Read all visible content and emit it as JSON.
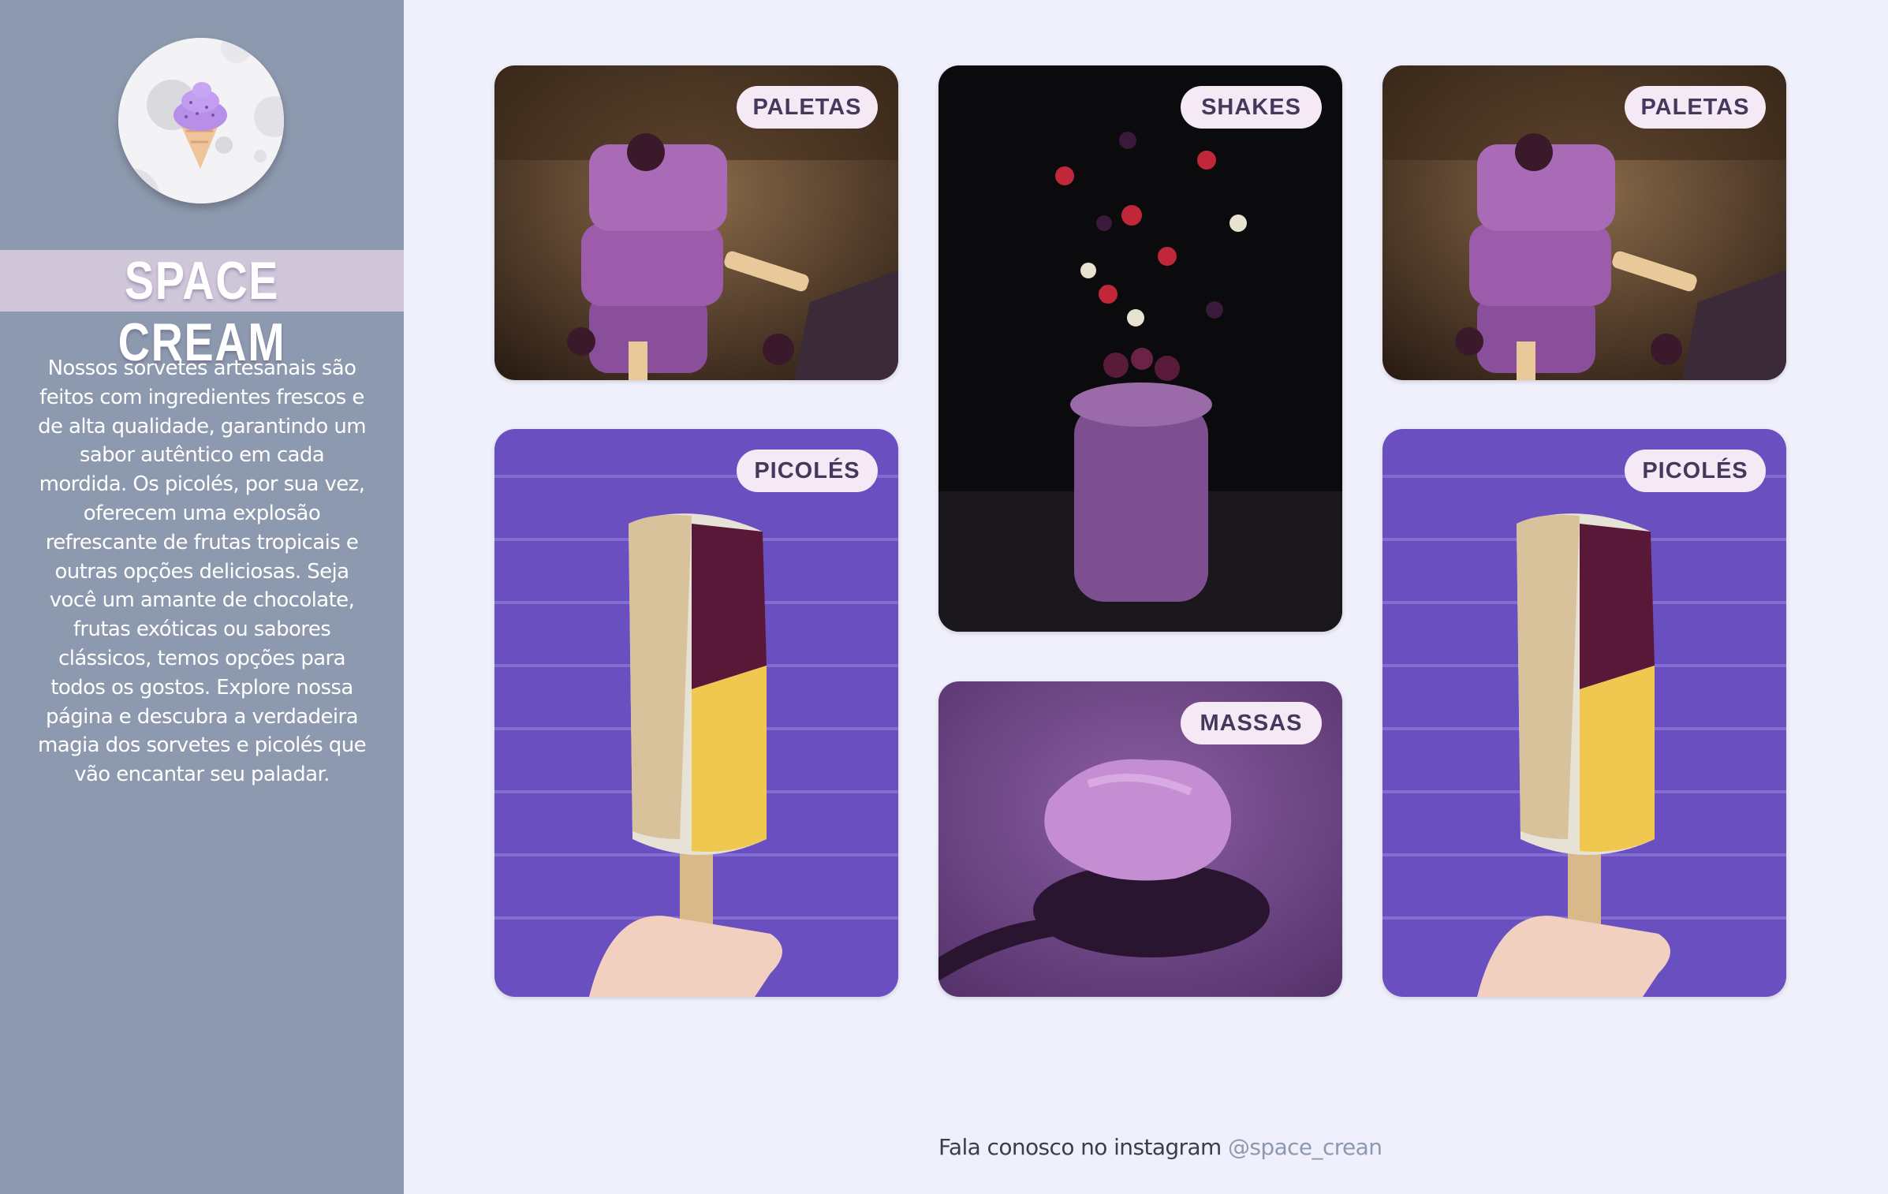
{
  "brand": {
    "title": "SPACE CREAM",
    "logo_icon": "ice-cream-cone-icon",
    "description": "Nossos sorvetes artesanais são feitos com ingredientes frescos e de alta qualidade, garantindo um sabor autêntico em cada mordida. Os picolés, por sua vez, oferecem uma explosão refrescante de frutas tropicais e outras opções deliciosas. Seja você um amante de chocolate, frutas exóticas ou sabores clássicos, temos opções para todos os gostos. Explore nossa página e descubra a verdadeira magia dos sorvetes e picolés que vão encantar seu paladar."
  },
  "gallery": {
    "cards": [
      {
        "label": "PALETAS"
      },
      {
        "label": "SHAKES"
      },
      {
        "label": "PALETAS"
      },
      {
        "label": "PICOLÉS"
      },
      {
        "label": "MASSAS"
      },
      {
        "label": "PICOLÉS"
      }
    ]
  },
  "footer": {
    "text": "Fala conosco no instagram",
    "handle": "@space_crean"
  },
  "colors": {
    "sidebar": "#8d99ae",
    "background": "#eff0fb",
    "tag_background": "#f6e9f6",
    "tag_text": "#45385c",
    "link": "#8d99ae"
  }
}
